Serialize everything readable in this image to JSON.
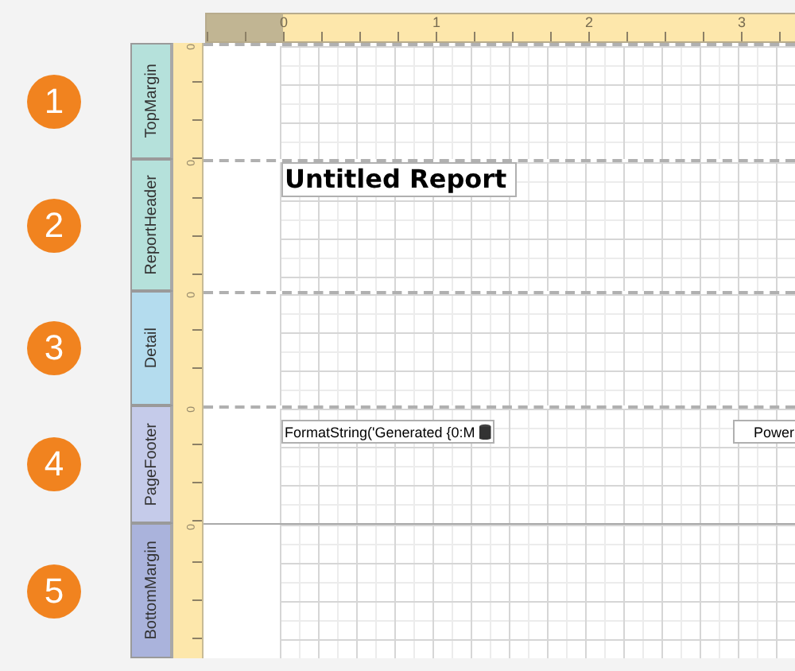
{
  "ruler": {
    "labels": [
      "0",
      "1",
      "2",
      "3"
    ]
  },
  "bands": [
    {
      "number": "1",
      "name": "TopMargin",
      "ruler_start": "0",
      "color": "#b5e1db"
    },
    {
      "number": "2",
      "name": "ReportHeader",
      "ruler_start": "0",
      "color": "#b5e1db",
      "controls": [
        {
          "kind": "title",
          "text": "Untitled Report"
        }
      ]
    },
    {
      "number": "3",
      "name": "Detail",
      "ruler_start": "0",
      "color": "#b4dcee"
    },
    {
      "number": "4",
      "name": "PageFooter",
      "ruler_start": "0",
      "color": "#c5cbea",
      "controls": [
        {
          "kind": "expression",
          "text": "FormatString('Generated {0:M"
        },
        {
          "kind": "label",
          "text": "Power"
        }
      ]
    },
    {
      "number": "5",
      "name": "BottomMargin",
      "ruler_start": "0",
      "color": "#aab3dc"
    }
  ]
}
